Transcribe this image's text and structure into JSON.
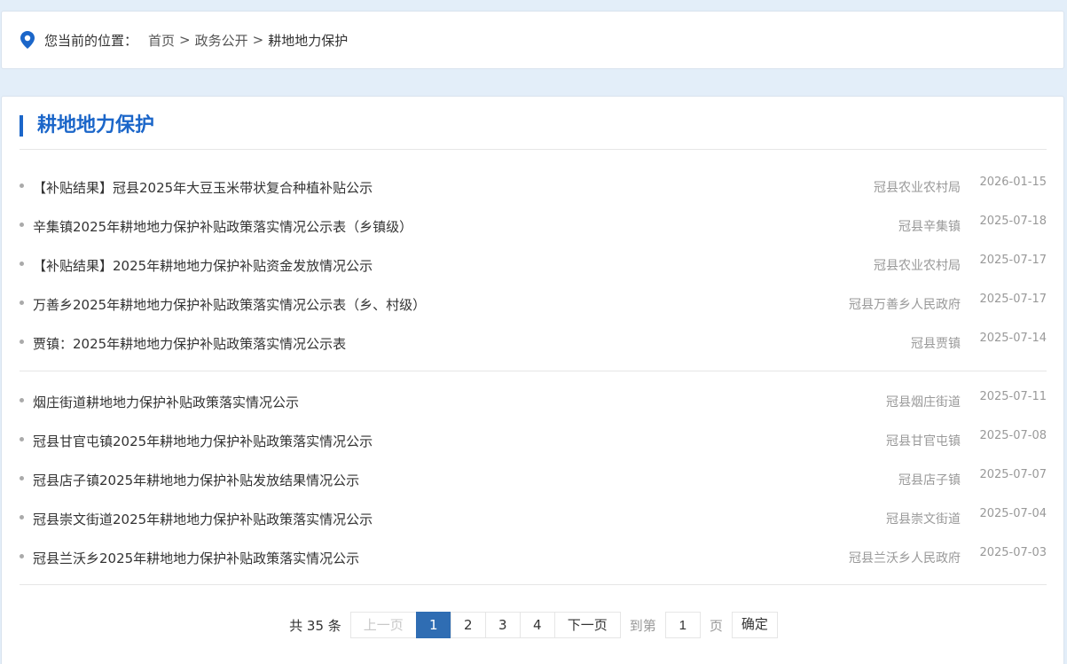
{
  "breadcrumb": {
    "prefix": "您当前的位置：",
    "items": [
      "首页",
      "政务公开",
      "耕地地力保护"
    ],
    "separator": ">"
  },
  "section": {
    "title": "耕地地力保护"
  },
  "news_group_1": [
    {
      "title": "【补贴结果】冠县2025年大豆玉米带状复合种植补贴公示",
      "source": "冠县农业农村局",
      "date": "2026-01-15"
    },
    {
      "title": "辛集镇2025年耕地地力保护补贴政策落实情况公示表（乡镇级）",
      "source": "冠县辛集镇",
      "date": "2025-07-18"
    },
    {
      "title": "【补贴结果】2025年耕地地力保护补贴资金发放情况公示",
      "source": "冠县农业农村局",
      "date": "2025-07-17"
    },
    {
      "title": "万善乡2025年耕地地力保护补贴政策落实情况公示表（乡、村级）",
      "source": "冠县万善乡人民政府",
      "date": "2025-07-17"
    },
    {
      "title": "贾镇：2025年耕地地力保护补贴政策落实情况公示表",
      "source": "冠县贾镇",
      "date": "2025-07-14"
    }
  ],
  "news_group_2": [
    {
      "title": "烟庄街道耕地地力保护补贴政策落实情况公示",
      "source": "冠县烟庄街道",
      "date": "2025-07-11"
    },
    {
      "title": "冠县甘官屯镇2025年耕地地力保护补贴政策落实情况公示",
      "source": "冠县甘官屯镇",
      "date": "2025-07-08"
    },
    {
      "title": "冠县店子镇2025年耕地地力保护补贴发放结果情况公示",
      "source": "冠县店子镇",
      "date": "2025-07-07"
    },
    {
      "title": "冠县崇文街道2025年耕地地力保护补贴政策落实情况公示",
      "source": "冠县崇文街道",
      "date": "2025-07-04"
    },
    {
      "title": "冠县兰沃乡2025年耕地地力保护补贴政策落实情况公示",
      "source": "冠县兰沃乡人民政府",
      "date": "2025-07-03"
    }
  ],
  "pagination": {
    "total": "共 35 条",
    "prev": "上一页",
    "pages": [
      "1",
      "2",
      "3",
      "4"
    ],
    "current": "1",
    "next": "下一页",
    "goto_label": "到第",
    "goto_value": "1",
    "page_unit": "页",
    "confirm": "确定"
  },
  "colors": {
    "accent": "#1b66c9",
    "active_page": "#2f6db3",
    "background": "#e3eef9"
  },
  "icons": {
    "location": "location-pin-icon"
  }
}
